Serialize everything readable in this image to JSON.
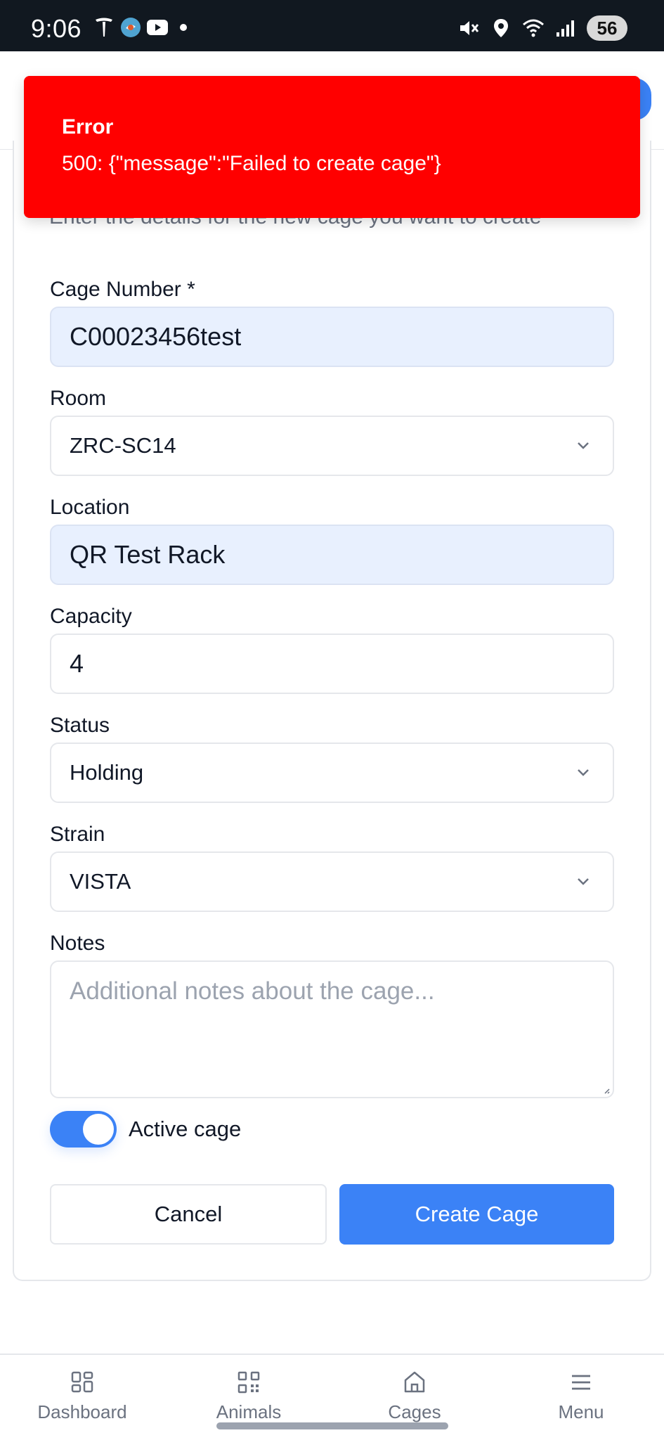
{
  "status_bar": {
    "time": "9:06",
    "battery": "56",
    "left_icons": [
      "tesla-icon",
      "chat-app-icon",
      "youtube-icon",
      "notification-dot"
    ],
    "right_icons": [
      "mute-icon",
      "location-icon",
      "wifi-icon",
      "signal-icon"
    ]
  },
  "toast": {
    "title": "Error",
    "message": "500: {\"message\":\"Failed to create cage\"}",
    "color": "#ff0000"
  },
  "card": {
    "description": "Enter the details for the new cage you want to create"
  },
  "form": {
    "cage_number": {
      "label": "Cage Number *",
      "value": "C00023456test"
    },
    "room": {
      "label": "Room",
      "value": "ZRC-SC14"
    },
    "location": {
      "label": "Location",
      "value": "QR Test Rack"
    },
    "capacity": {
      "label": "Capacity",
      "value": "4"
    },
    "status": {
      "label": "Status",
      "value": "Holding"
    },
    "strain": {
      "label": "Strain",
      "value": "VISTA"
    },
    "notes": {
      "label": "Notes",
      "placeholder": "Additional notes about the cage..."
    },
    "active": {
      "label": "Active cage",
      "checked": true
    }
  },
  "buttons": {
    "cancel": "Cancel",
    "create": "Create Cage",
    "accent": "#3b82f6"
  },
  "bottom_nav": {
    "items": [
      {
        "label": "Dashboard",
        "icon": "grid-icon"
      },
      {
        "label": "Animals",
        "icon": "qr-code-icon"
      },
      {
        "label": "Cages",
        "icon": "home-icon"
      },
      {
        "label": "Menu",
        "icon": "menu-icon"
      }
    ]
  }
}
